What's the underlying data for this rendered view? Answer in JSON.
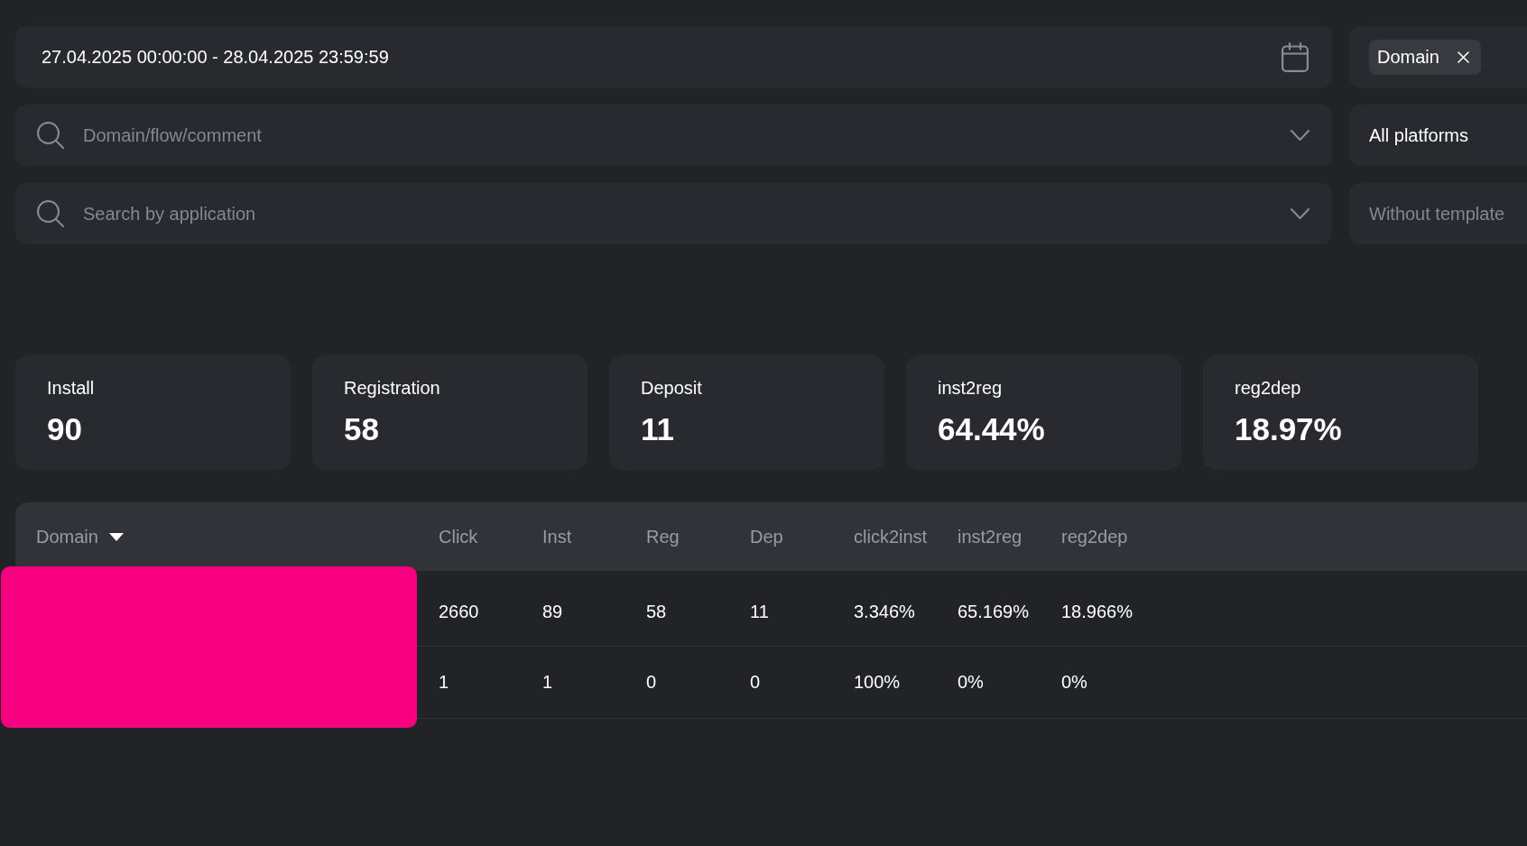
{
  "filters": {
    "date_range": {
      "value": "27.04.2025 00:00:00 - 28.04.2025 23:59:59"
    },
    "group_by": {
      "chips": [
        {
          "label": "Domain"
        }
      ]
    },
    "search_fields": [
      {
        "placeholder": "Domain/flow/comment"
      },
      {
        "placeholder": "Search by application"
      }
    ],
    "platform": {
      "value": "All platforms"
    },
    "template": {
      "placeholder": "Without template"
    }
  },
  "stats": [
    {
      "label": "Install",
      "value": "90"
    },
    {
      "label": "Registration",
      "value": "58"
    },
    {
      "label": "Deposit",
      "value": "11"
    },
    {
      "label": "inst2reg",
      "value": "64.44%"
    },
    {
      "label": "reg2dep",
      "value": "18.97%"
    }
  ],
  "table": {
    "columns": [
      {
        "label": "Domain",
        "sorted": true
      },
      {
        "label": "Click",
        "sorted": false
      },
      {
        "label": "Inst",
        "sorted": false
      },
      {
        "label": "Reg",
        "sorted": false
      },
      {
        "label": "Dep",
        "sorted": false
      },
      {
        "label": "click2inst",
        "sorted": false
      },
      {
        "label": "inst2reg",
        "sorted": false
      },
      {
        "label": "reg2dep",
        "sorted": false
      }
    ],
    "rows": [
      {
        "values": [
          "2660",
          "89",
          "58",
          "11",
          "3.346%",
          "65.169%",
          "18.966%"
        ]
      },
      {
        "values": [
          "1",
          "1",
          "0",
          "0",
          "100%",
          "0%",
          "0%"
        ]
      }
    ],
    "domain_redacted": true
  }
}
